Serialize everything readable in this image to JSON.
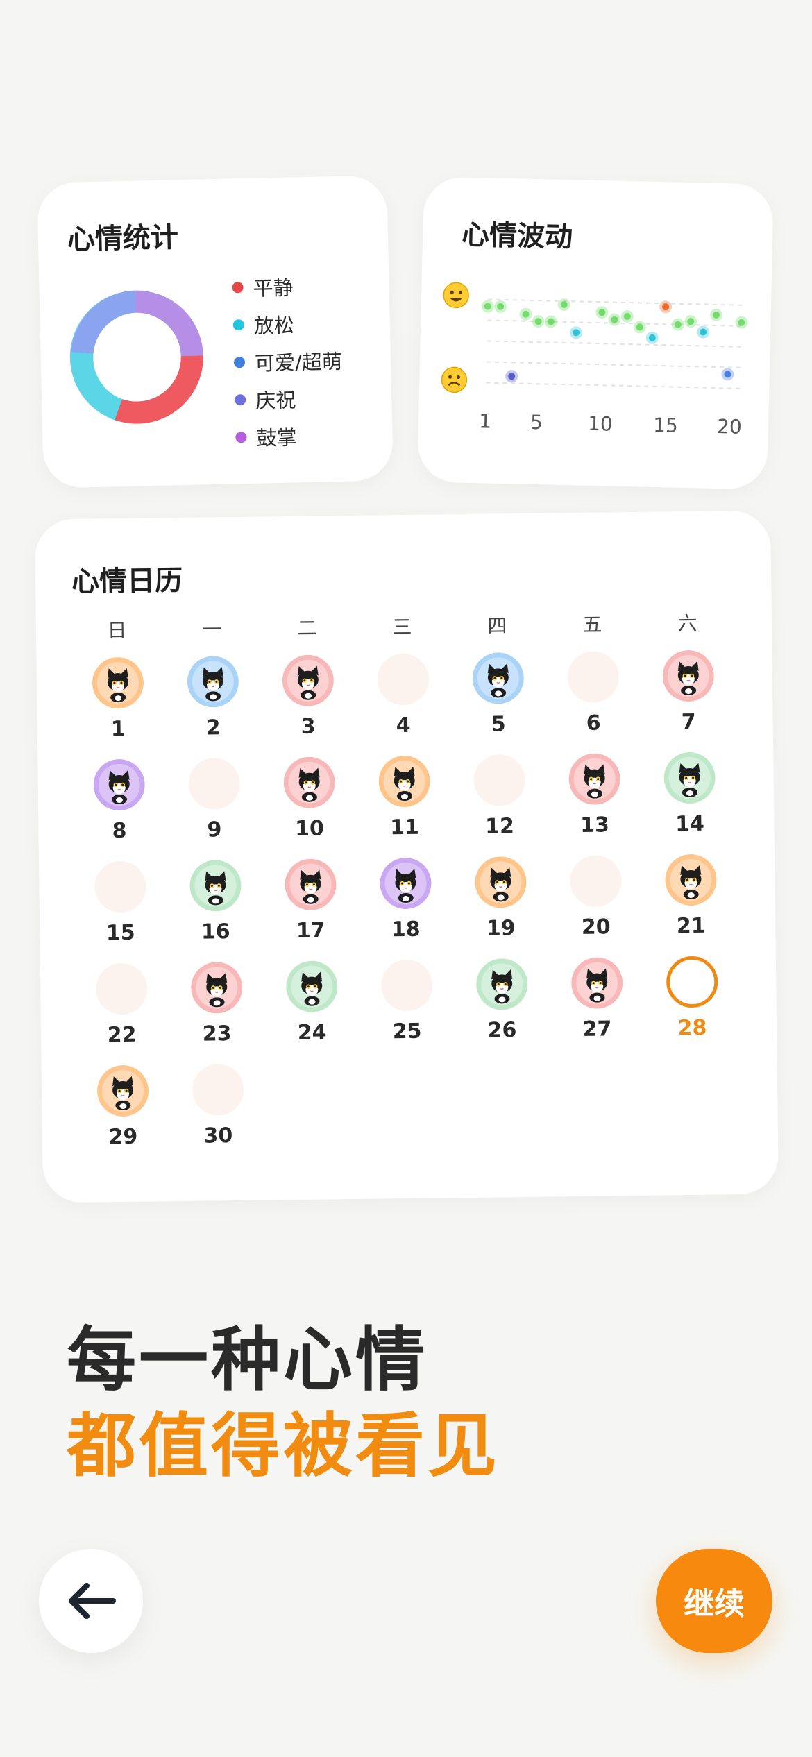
{
  "stats_card": {
    "title": "心情统计",
    "legend": [
      {
        "label": "平静",
        "color": "#e84545"
      },
      {
        "label": "放松",
        "color": "#1fc8e0"
      },
      {
        "label": "可爱/超萌",
        "color": "#3e82e0"
      },
      {
        "label": "庆祝",
        "color": "#6d6fe0"
      },
      {
        "label": "鼓掌",
        "color": "#b55ee0"
      }
    ]
  },
  "wave_card": {
    "title": "心情波动",
    "happy_icon": "happy-face-emoji",
    "sad_icon": "sad-face-emoji",
    "x_ticks": [
      "1",
      "5",
      "10",
      "15",
      "20"
    ]
  },
  "chart_data": {
    "type": "scatter",
    "x": [
      1,
      2,
      3,
      4,
      5,
      6,
      7,
      8,
      10,
      11,
      12,
      13,
      14,
      15,
      16,
      17,
      18,
      19,
      20,
      21
    ],
    "y": [
      3,
      3,
      1,
      2.8,
      2.6,
      2.6,
      3.1,
      2.3,
      2.9,
      2.7,
      2.8,
      2.5,
      2.2,
      3.1,
      2.6,
      2.7,
      2.4,
      2.9,
      1.2,
      2.7
    ],
    "colors": [
      "#74dc6c",
      "#74dc6c",
      "#5a5fd0",
      "#74dc6c",
      "#74dc6c",
      "#74dc6c",
      "#74dc6c",
      "#2fc3d8",
      "#74dc6c",
      "#74dc6c",
      "#74dc6c",
      "#74dc6c",
      "#2fc3d8",
      "#f06a2a",
      "#74dc6c",
      "#74dc6c",
      "#2fc3d8",
      "#74dc6c",
      "#4a7ee0",
      "#74dc6c"
    ],
    "x_ticks": [
      1,
      5,
      10,
      15,
      20
    ],
    "xlim": [
      1,
      20
    ],
    "ylim": [
      0,
      4
    ],
    "grid": true
  },
  "calendar": {
    "title": "心情日历",
    "weekdays": [
      "日",
      "一",
      "二",
      "三",
      "四",
      "五",
      "六"
    ],
    "days": [
      {
        "day": "1",
        "mood": "orange"
      },
      {
        "day": "2",
        "mood": "blue"
      },
      {
        "day": "3",
        "mood": "pink"
      },
      {
        "day": "4",
        "mood": "empty"
      },
      {
        "day": "5",
        "mood": "blue"
      },
      {
        "day": "6",
        "mood": "empty"
      },
      {
        "day": "7",
        "mood": "pink"
      },
      {
        "day": "8",
        "mood": "purple"
      },
      {
        "day": "9",
        "mood": "empty"
      },
      {
        "day": "10",
        "mood": "pink"
      },
      {
        "day": "11",
        "mood": "orange"
      },
      {
        "day": "12",
        "mood": "empty"
      },
      {
        "day": "13",
        "mood": "pink"
      },
      {
        "day": "14",
        "mood": "green"
      },
      {
        "day": "15",
        "mood": "empty"
      },
      {
        "day": "16",
        "mood": "green"
      },
      {
        "day": "17",
        "mood": "pink"
      },
      {
        "day": "18",
        "mood": "purple"
      },
      {
        "day": "19",
        "mood": "orange"
      },
      {
        "day": "20",
        "mood": "empty"
      },
      {
        "day": "21",
        "mood": "orange"
      },
      {
        "day": "22",
        "mood": "empty"
      },
      {
        "day": "23",
        "mood": "pink"
      },
      {
        "day": "24",
        "mood": "green"
      },
      {
        "day": "25",
        "mood": "empty"
      },
      {
        "day": "26",
        "mood": "green"
      },
      {
        "day": "27",
        "mood": "pink"
      },
      {
        "day": "28",
        "mood": "today"
      },
      {
        "day": "29",
        "mood": "orange"
      },
      {
        "day": "30",
        "mood": "empty"
      }
    ],
    "mood_colors": {
      "orange": "#ffc58a",
      "blue": "#a9d3f7",
      "pink": "#f9b8b8",
      "purple": "#c9a7f2",
      "green": "#bfe8c9"
    }
  },
  "headline": {
    "line1": "每一种心情",
    "line2": "都值得被看见"
  },
  "back_button": {
    "icon": "arrow-left-icon"
  },
  "continue_button": {
    "label": "继续"
  }
}
